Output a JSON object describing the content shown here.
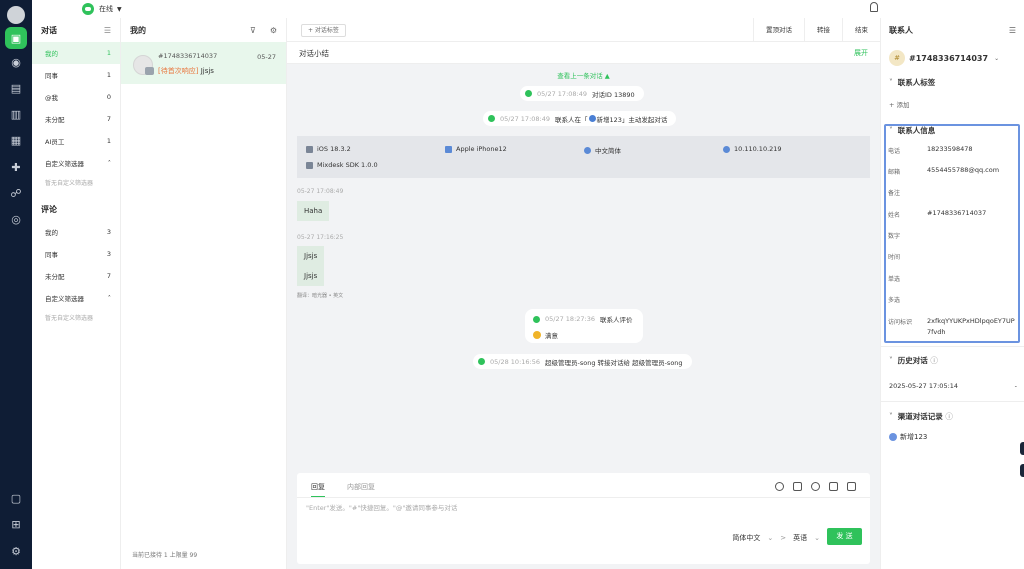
{
  "status": {
    "label": "在线"
  },
  "nav": {
    "conv_section": "对话",
    "conv_items": [
      {
        "label": "我的",
        "count": "1"
      },
      {
        "label": "同事",
        "count": "1"
      },
      {
        "label": "@我",
        "count": "0"
      },
      {
        "label": "未分配",
        "count": "7"
      },
      {
        "label": "AI员工",
        "count": "1"
      }
    ],
    "custom_filter": "自定义筛选器",
    "no_filter": "暂无自定义筛选器",
    "comment_section": "评论",
    "comment_items": [
      {
        "label": "我的",
        "count": "3"
      },
      {
        "label": "同事",
        "count": "3"
      },
      {
        "label": "未分配",
        "count": "7"
      }
    ],
    "custom_filter_2": "自定义筛选器",
    "no_filter_2": "暂无自定义筛选器"
  },
  "list": {
    "title": "我的",
    "card": {
      "id": "#1748336714037",
      "date": "05-27",
      "tag": "[待首次响应]",
      "text": "Jjsjs"
    },
    "footer": "当前已接待 1 上限量 99"
  },
  "chat": {
    "tag_button": "+ 对话标签",
    "actions": [
      "置顶对话",
      "转接",
      "结束"
    ],
    "summary_label": "对话小结",
    "summary_expand": "展开",
    "prev_link": "查看上一条对话 ▲",
    "sys1": {
      "time": "05/27 17:08:49",
      "text": "对话ID 13890"
    },
    "sys2": {
      "time": "05/27 17:08:49",
      "pre": "联系人在「",
      "channel": "新增123",
      "post": "」主动发起对话"
    },
    "info": {
      "os": "iOS 18.3.2",
      "device": "Apple iPhone12",
      "lang": "中文简体",
      "ip": "10.110.10.219",
      "sdk": "Mixdesk SDK 1.0.0"
    },
    "ts1": "05-27 17:08:49",
    "msg1": "Haha",
    "ts2": "05-27 17:16:25",
    "msg2a": "Jjsjs",
    "msg2b": "Jjsjs",
    "translate": "翻译：暗光器 • 英文",
    "eval": {
      "time": "05/27 18:27:36",
      "title": "联系人评价",
      "result": "满意"
    },
    "sys3": {
      "time": "05/28 10:16:56",
      "text": "超级管理员-song 转接对话给 超级管理员-song"
    }
  },
  "compose": {
    "tab_reply": "回复",
    "tab_internal": "内部回复",
    "placeholder": "\"Enter\"发送。\"#\"快捷回复。\"@\"邀请同事参与对话",
    "lang_from": "简体中文",
    "lang_to": "英语",
    "send": "发 送"
  },
  "contact": {
    "title": "联系人",
    "id": "#1748336714037",
    "tags_section": "联系人标签",
    "add": "+ 添加",
    "info_section": "联系人信息",
    "fields": [
      {
        "label": "电话",
        "value": "18233598478"
      },
      {
        "label": "邮箱",
        "value": "4554455788@qq.com"
      },
      {
        "label": "备注",
        "value": ""
      },
      {
        "label": "姓名",
        "value": "#1748336714037"
      },
      {
        "label": "数字",
        "value": ""
      },
      {
        "label": "时间",
        "value": ""
      },
      {
        "label": "单选",
        "value": ""
      },
      {
        "label": "多选",
        "value": ""
      },
      {
        "label": "访问标识",
        "value": "2xfkqYYUKPxHDlpqoEY7UP7fvdh"
      }
    ],
    "history_section": "历史对话",
    "history_item": "2025-05-27 17:05:14",
    "history_dash": "-",
    "channel_section": "渠道对话记录",
    "channel_item": "新增123"
  },
  "colors": {
    "accent": "#2fc25b",
    "rail": "#0f1d35",
    "highlight_border": "#6b93e0"
  }
}
